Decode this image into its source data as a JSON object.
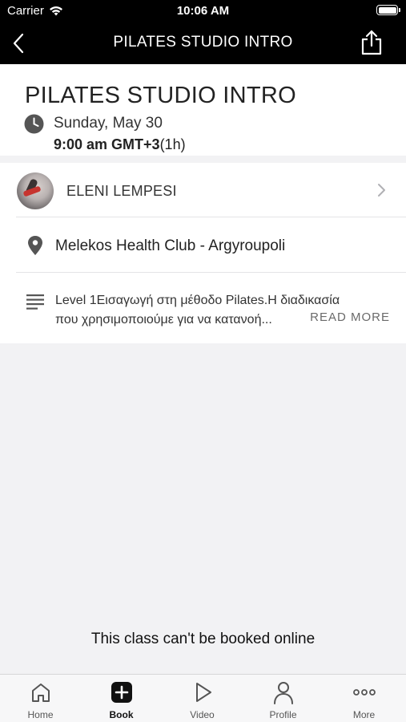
{
  "status_bar": {
    "carrier": "Carrier",
    "time": "10:06 AM"
  },
  "nav": {
    "title": "PILATES STUDIO INTRO",
    "back_icon": "chevron-left-icon",
    "share_icon": "share-icon"
  },
  "class": {
    "title": "PILATES STUDIO INTRO",
    "date": "Sunday, May 30",
    "time": "9:00 am GMT+3",
    "duration": "(1h)"
  },
  "instructor": {
    "name": "ELENI LEMPESI"
  },
  "location": {
    "name": "Melekos Health Club - Argyroupoli"
  },
  "description": {
    "line1": "Level 1Εισαγωγή στη μέθοδο Pilates.Η διαδικασία",
    "line2": "που χρησιμοποιούμε για να κατανοή...",
    "read_more": "READ MORE"
  },
  "booking": {
    "note": "This class can't be booked online"
  },
  "tabs": [
    {
      "label": "Home",
      "icon": "home-icon"
    },
    {
      "label": "Book",
      "icon": "plus-square-icon"
    },
    {
      "label": "Video",
      "icon": "play-icon"
    },
    {
      "label": "Profile",
      "icon": "person-icon"
    },
    {
      "label": "More",
      "icon": "more-dots-icon"
    }
  ],
  "colors": {
    "header_bg": "#000000",
    "page_bg": "#f2f2f4",
    "card_bg": "#ffffff"
  }
}
